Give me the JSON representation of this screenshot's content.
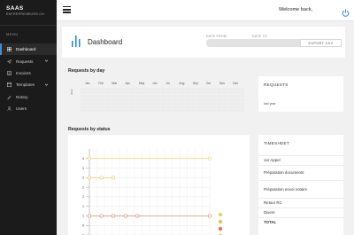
{
  "brand": {
    "name": "SAAS",
    "subtitle": "ENTREPRENEURS.CH"
  },
  "sidebar": {
    "menu_title": "MENU",
    "items": [
      {
        "label": "Dashboard",
        "icon": "dashboard-icon",
        "active": true,
        "chevron": false
      },
      {
        "label": "Requests",
        "icon": "request-icon",
        "active": false,
        "chevron": true
      },
      {
        "label": "Invoices",
        "icon": "invoice-icon",
        "active": false,
        "chevron": false
      },
      {
        "label": "Templates",
        "icon": "template-icon",
        "active": false,
        "chevron": true
      },
      {
        "label": "Notary",
        "icon": "notary-icon",
        "active": false,
        "chevron": false
      },
      {
        "label": "Users",
        "icon": "users-icon",
        "active": false,
        "chevron": false
      }
    ]
  },
  "topbar": {
    "welcome": "Welcome back,"
  },
  "header": {
    "title": "Dashboard",
    "date_from_label": "DATE FROM",
    "date_to_label": "DATE TO",
    "date_from_value": "",
    "date_to_value": "",
    "export_label": "EXPORT CSV"
  },
  "requests_by_day": {
    "title": "Requests by day",
    "year": "2022",
    "months": [
      "Jan",
      "Feb",
      "Mar",
      "Apr",
      "May",
      "Jun",
      "Jul",
      "Aug",
      "Sep",
      "Oct",
      "Nov",
      "Dec"
    ]
  },
  "requests_card": {
    "title": "REQUESTS",
    "footer": "last year"
  },
  "requests_by_status": {
    "title": "Requests by status"
  },
  "chart_data": {
    "type": "line",
    "yticks": [
      "4",
      "3",
      "3",
      "2",
      "2",
      "1",
      "1",
      "0",
      "0"
    ],
    "series": [
      {
        "color": "#e8d35a",
        "points": [
          [
            0,
            4
          ],
          [
            10,
            4
          ]
        ]
      },
      {
        "color": "#e6c25a",
        "points": [
          [
            0,
            3
          ],
          [
            1,
            3
          ],
          [
            2,
            3
          ]
        ]
      },
      {
        "color": "#d97a57",
        "points": [
          [
            0,
            1
          ],
          [
            1,
            1
          ],
          [
            2,
            1
          ],
          [
            3,
            1
          ],
          [
            4,
            1
          ],
          [
            10,
            1
          ]
        ]
      }
    ],
    "ylim": [
      0,
      4.5
    ],
    "grid": true
  },
  "timesheet": {
    "title": "TIMESHEET",
    "items": [
      "1er Appel",
      "Préparation documents",
      "Préparation envoi notaire",
      "Retour RC",
      "Divers",
      "TOTAL"
    ]
  },
  "colors": {
    "accent": "#2e8bd6",
    "sidebar_bg": "#1b1b1b",
    "power": "#2e8bd6"
  }
}
